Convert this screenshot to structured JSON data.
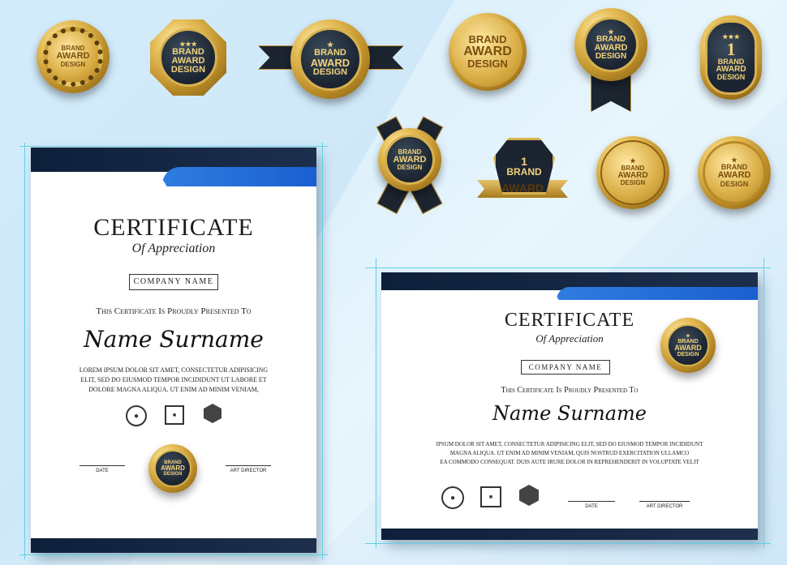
{
  "badges": [
    {
      "l1": "BRAND",
      "l2": "AWARD",
      "l3": "DESIGN"
    },
    {
      "l1": "BRAND",
      "l2": "AWARD",
      "l3": "DESIGN"
    },
    {
      "l1": "BRAND",
      "l2": "AWARD",
      "l3": "DESIGN"
    },
    {
      "l1": "BRAND",
      "l2": "AWARD",
      "l3": "DESIGN"
    },
    {
      "l1": "BRAND",
      "l2": "AWARD",
      "l3": "DESIGN"
    },
    {
      "num": "1",
      "l1": "BRAND",
      "l2": "AWARD",
      "l3": "DESIGN"
    },
    {
      "l1": "BRAND",
      "l2": "AWARD",
      "l3": "DESIGN"
    },
    {
      "num": "1",
      "l1": "BRAND",
      "l2": "AWARD"
    },
    {
      "l1": "BRAND",
      "l2": "AWARD",
      "l3": "DESIGN"
    },
    {
      "l1": "BRAND",
      "l2": "AWARD",
      "l3": "DESIGN"
    }
  ],
  "portrait": {
    "title": "CERTIFICATE",
    "subtitle": "Of Appreciation",
    "company": "COMPANY NAME",
    "presented": "This Certificate Is Proudly Presented To",
    "name": "Name Surname",
    "lorem_1": "Lorem ipsum dolor sit amet, consectetur adipisicing",
    "lorem_2": "elit, sed do eiusmod tempor incididunt ut labore et",
    "lorem_3": "dolore magna aliqua. Ut enim ad minim veniam,",
    "date_label": "DATE",
    "director_label": "ART DIRECTOR",
    "seal": {
      "l1": "BRAND",
      "l2": "AWARD",
      "l3": "DESIGN"
    }
  },
  "landscape": {
    "title": "CERTIFICATE",
    "subtitle": "Of Appreciation",
    "company": "COMPANY NAME",
    "presented": "This Certificate Is Proudly Presented To",
    "name": "Name Surname",
    "lorem_1": "Ipsum dolor sit amet, consectetur adipisicing elit, sed do eiusmod tempor incididunt",
    "lorem_2": "magna aliqua. Ut enim ad minim veniam, quis nostrud exercitation ullamco",
    "lorem_3": "ea commodo consequat. Duis aute irure dolor in reprehenderit in voluptate velit",
    "date_label": "DATE",
    "director_label": "ART DIRECTOR",
    "seal": {
      "l1": "BRAND",
      "l2": "AWARD",
      "l3": "DESIGN"
    }
  },
  "colors": {
    "navy": "#0d1f3a",
    "blue": "#2f7de0",
    "gold": "#d9ad45"
  }
}
